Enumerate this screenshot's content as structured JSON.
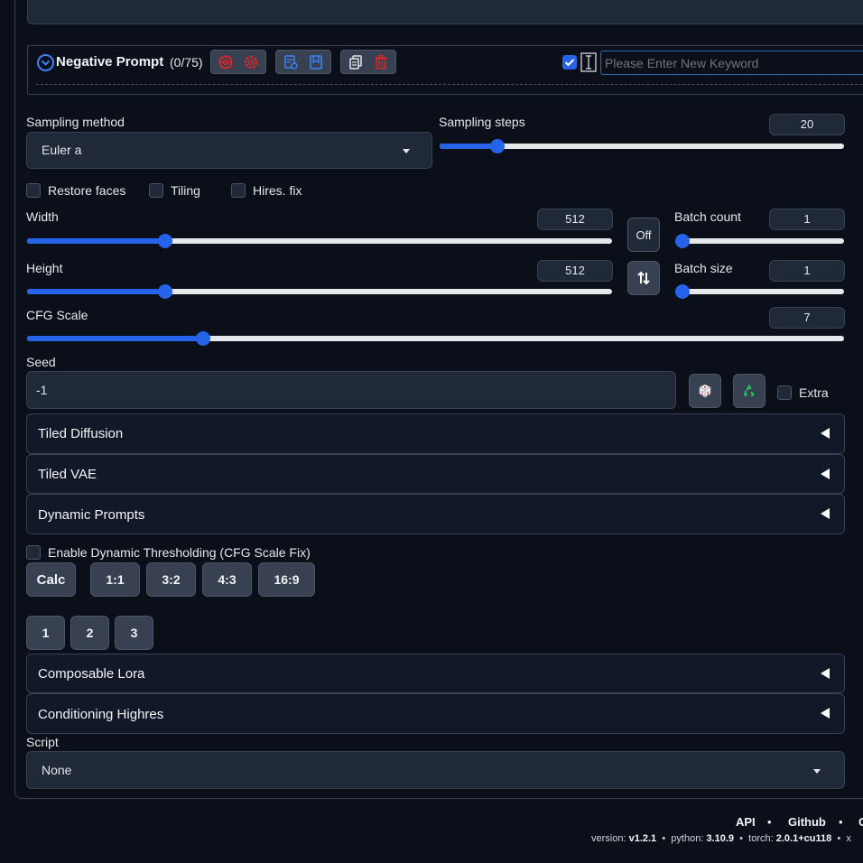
{
  "negative_prompt": {
    "title": "Negative Prompt",
    "count": "(0/75)",
    "keyword_placeholder": "Please Enter New Keyword"
  },
  "sampling": {
    "method_label": "Sampling method",
    "method_value": "Euler a",
    "steps_label": "Sampling steps",
    "steps_value": "20",
    "steps_fraction": 0.13
  },
  "options": {
    "restore_faces": "Restore faces",
    "tiling": "Tiling",
    "hires_fix": "Hires. fix"
  },
  "size": {
    "width_label": "Width",
    "width_value": "512",
    "width_fraction": 0.23,
    "height_label": "Height",
    "height_value": "512",
    "height_fraction": 0.23,
    "off_button": "Off"
  },
  "batch": {
    "count_label": "Batch count",
    "count_value": "1",
    "count_fraction": 0.0,
    "size_label": "Batch size",
    "size_value": "1",
    "size_fraction": 0.0
  },
  "cfg": {
    "label": "CFG Scale",
    "value": "7",
    "fraction": 0.21
  },
  "seed": {
    "label": "Seed",
    "value": "-1",
    "extra_label": "Extra"
  },
  "accordions": {
    "tiled_diffusion": "Tiled Diffusion",
    "tiled_vae": "Tiled VAE",
    "dynamic_prompts": "Dynamic Prompts",
    "composable_lora": "Composable Lora",
    "conditioning_highres": "Conditioning Highres"
  },
  "dynamic_thresholding": {
    "label": "Enable Dynamic Thresholding (CFG Scale Fix)"
  },
  "ratio_buttons": {
    "calc": "Calc",
    "r1": "1:1",
    "r2": "3:2",
    "r3": "4:3",
    "r4": "16:9"
  },
  "number_buttons": {
    "b1": "1",
    "b2": "2",
    "b3": "3"
  },
  "script": {
    "label": "Script",
    "value": "None"
  },
  "footer": {
    "api": "API",
    "github": "Github",
    "truncated": "G",
    "sep": "•",
    "version_label": "version:",
    "version": "v1.2.1",
    "python_label": "python:",
    "python": "3.10.9",
    "torch_label": "torch:",
    "torch": "2.0.1+cu118",
    "trailing": "x"
  },
  "colors": {
    "accent": "#2563eb",
    "background": "#0b0f19",
    "panel": "#1f2937",
    "red_icon": "#dc2626",
    "blue_icon": "#3b82f6",
    "green_icon": "#22c55e"
  }
}
